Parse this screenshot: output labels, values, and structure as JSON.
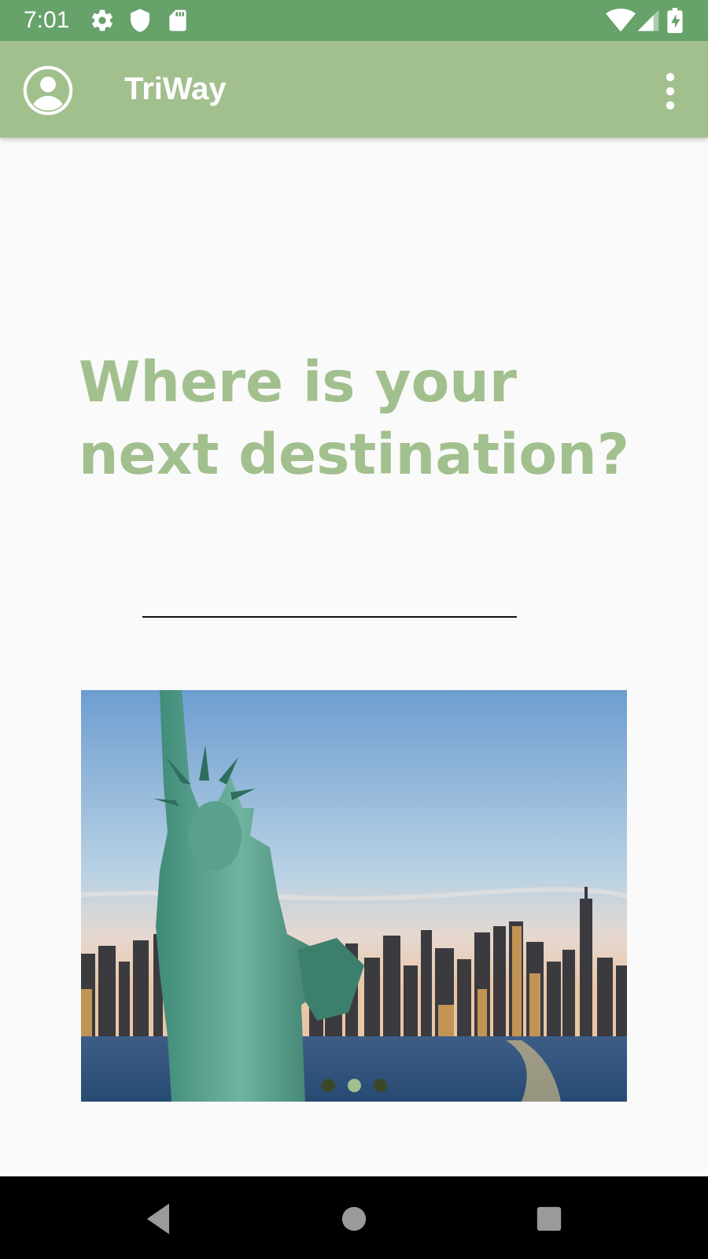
{
  "status_bar": {
    "time": "7:01",
    "left_icons": [
      "settings-icon",
      "shield-icon",
      "sd-card-icon"
    ],
    "right_icons": [
      "wifi-icon",
      "cell-signal-icon",
      "battery-charging-icon"
    ],
    "color": "#66a26a"
  },
  "app_bar": {
    "title": "TriWay",
    "left_icon": "account-circle-icon",
    "right_icon": "more-vert-icon",
    "color": "#a2c08e"
  },
  "main": {
    "headline_line1": "Where is your",
    "headline_line2": "next destination?",
    "headline_color": "#a2c08e",
    "destination_input": {
      "value": "",
      "placeholder": ""
    }
  },
  "carousel": {
    "image_subject": "Statue of Liberty with New York City skyline",
    "slide_count": 3,
    "active_index": 1,
    "dot_color": "#3b4726",
    "active_dot_color": "#a2c08e"
  },
  "nav_bar": {
    "buttons": [
      "back-icon",
      "home-icon",
      "recents-icon"
    ]
  }
}
